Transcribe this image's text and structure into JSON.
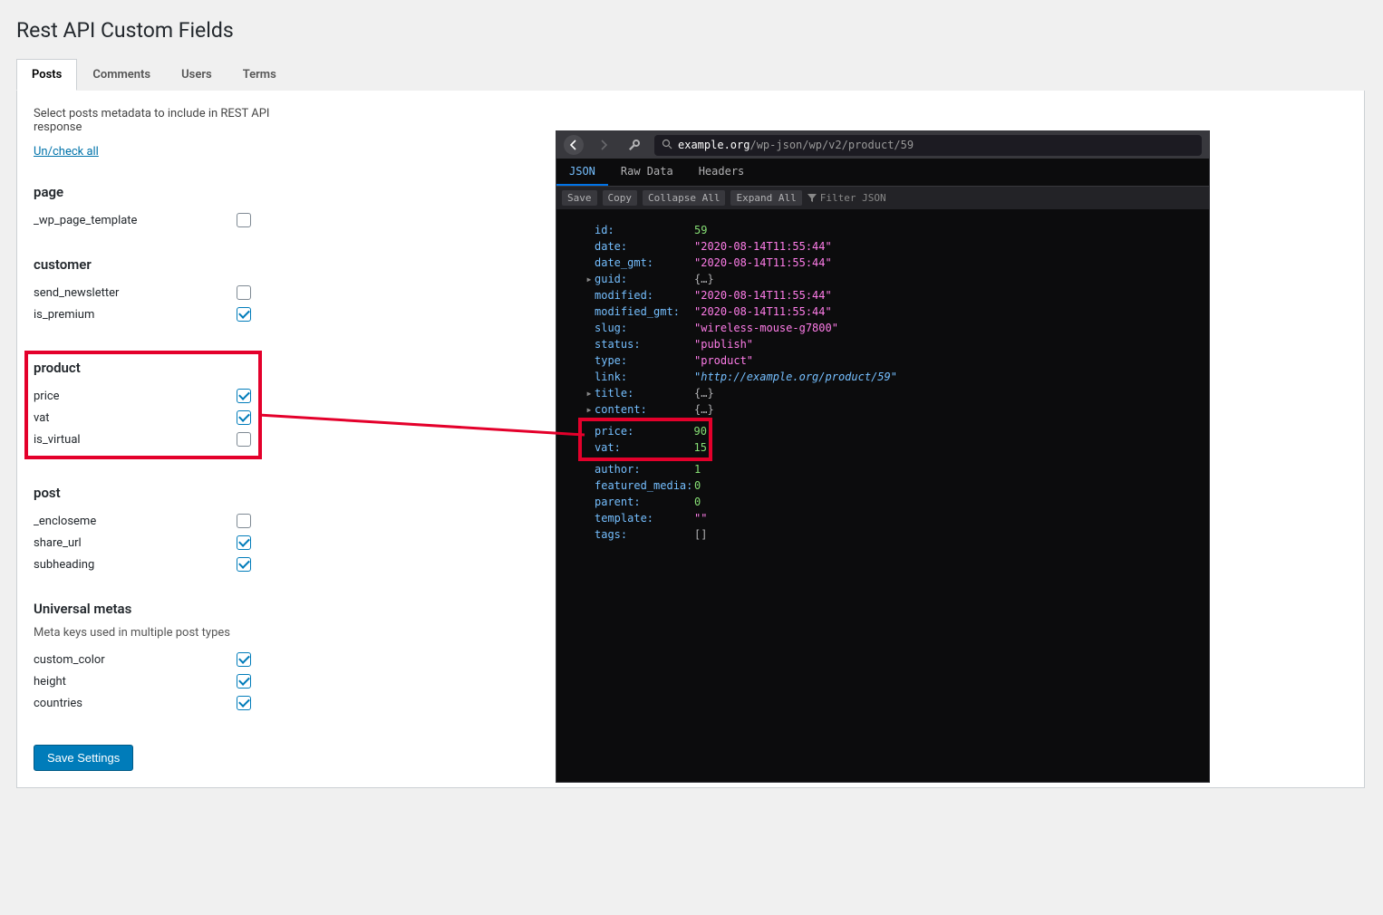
{
  "page_title": "Rest API Custom Fields",
  "tabs": [
    "Posts",
    "Comments",
    "Users",
    "Terms"
  ],
  "active_tab": 0,
  "description": "Select posts metadata to include in REST API response",
  "uncheck_label": "Un/check all",
  "sections": [
    {
      "id": "page",
      "title": "page",
      "highlight": false,
      "fields": [
        {
          "label": "_wp_page_template",
          "checked": false
        }
      ]
    },
    {
      "id": "customer",
      "title": "customer",
      "highlight": false,
      "fields": [
        {
          "label": "send_newsletter",
          "checked": false
        },
        {
          "label": "is_premium",
          "checked": true
        }
      ]
    },
    {
      "id": "product",
      "title": "product",
      "highlight": true,
      "fields": [
        {
          "label": "price",
          "checked": true
        },
        {
          "label": "vat",
          "checked": true
        },
        {
          "label": "is_virtual",
          "checked": false
        }
      ]
    },
    {
      "id": "post",
      "title": "post",
      "highlight": false,
      "fields": [
        {
          "label": "_encloseme",
          "checked": false
        },
        {
          "label": "share_url",
          "checked": true
        },
        {
          "label": "subheading",
          "checked": true
        }
      ]
    },
    {
      "id": "universal",
      "title": "Universal metas",
      "subdesc": "Meta keys used in multiple post types",
      "highlight": false,
      "fields": [
        {
          "label": "custom_color",
          "checked": true
        },
        {
          "label": "height",
          "checked": true
        },
        {
          "label": "countries",
          "checked": true
        }
      ]
    }
  ],
  "save_label": "Save Settings",
  "devtools": {
    "url_host": "example.org",
    "url_path": "/wp-json/wp/v2/product/59",
    "tabs": [
      "JSON",
      "Raw Data",
      "Headers"
    ],
    "active_tab": 0,
    "toolbar": [
      "Save",
      "Copy",
      "Collapse All",
      "Expand All"
    ],
    "filter_label": "Filter JSON",
    "json": [
      {
        "key": "id",
        "val": "59",
        "type": "num"
      },
      {
        "key": "date",
        "val": "\"2020-08-14T11:55:44\"",
        "type": "str"
      },
      {
        "key": "date_gmt",
        "val": "\"2020-08-14T11:55:44\"",
        "type": "str"
      },
      {
        "key": "guid",
        "val": "{…}",
        "type": "obj",
        "expand": true
      },
      {
        "key": "modified",
        "val": "\"2020-08-14T11:55:44\"",
        "type": "str"
      },
      {
        "key": "modified_gmt",
        "val": "\"2020-08-14T11:55:44\"",
        "type": "str"
      },
      {
        "key": "slug",
        "val": "\"wireless-mouse-g7800\"",
        "type": "str"
      },
      {
        "key": "status",
        "val": "\"publish\"",
        "type": "str"
      },
      {
        "key": "type",
        "val": "\"product\"",
        "type": "str"
      },
      {
        "key": "link",
        "val": "\"http://example.org/product/59\"",
        "type": "link"
      },
      {
        "key": "title",
        "val": "{…}",
        "type": "obj",
        "expand": true
      },
      {
        "key": "content",
        "val": "{…}",
        "type": "obj",
        "expand": true
      },
      {
        "key": "price",
        "val": "90",
        "type": "num",
        "highlight": true
      },
      {
        "key": "vat",
        "val": "15",
        "type": "num",
        "highlight": true
      },
      {
        "key": "author",
        "val": "1",
        "type": "num"
      },
      {
        "key": "featured_media",
        "val": "0",
        "type": "num"
      },
      {
        "key": "parent",
        "val": "0",
        "type": "num"
      },
      {
        "key": "template",
        "val": "\"\"",
        "type": "str"
      },
      {
        "key": "tags",
        "val": "[]",
        "type": "obj"
      }
    ]
  }
}
